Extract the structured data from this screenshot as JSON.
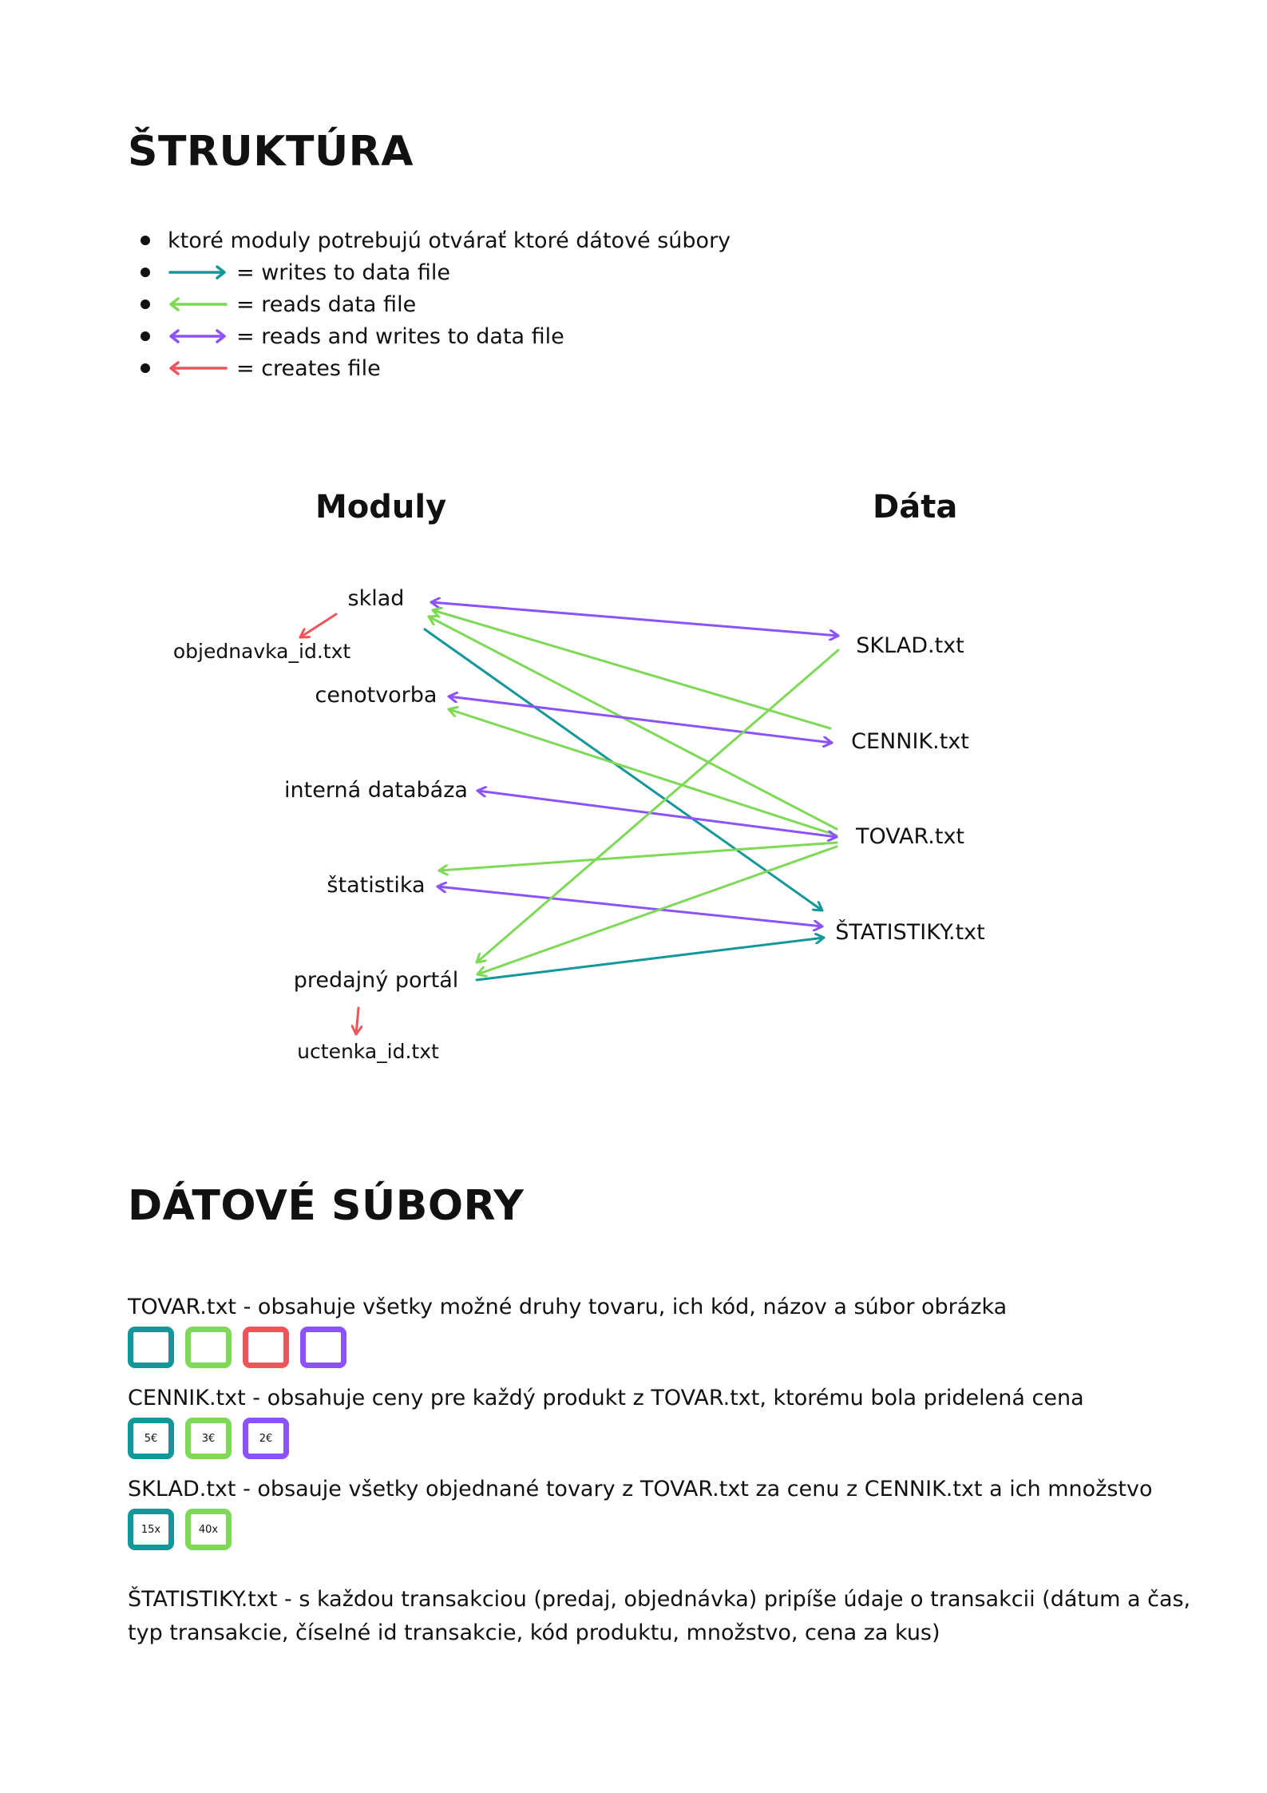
{
  "colors": {
    "teal": "#12979a",
    "green": "#7ed957",
    "red": "#f0545a",
    "purple": "#8c52ff"
  },
  "section1": {
    "title": "ŠTRUKTÚRA"
  },
  "legend": {
    "intro": "ktoré moduly potrebujú otvárať ktoré dátové súbory",
    "items": [
      {
        "color": "teal",
        "icon": "right-arrow-icon",
        "text": "= writes to data file"
      },
      {
        "color": "green",
        "icon": "left-arrow-icon",
        "text": "= reads data file"
      },
      {
        "color": "purple",
        "icon": "double-arrow-icon",
        "text": "= reads and writes to data file"
      },
      {
        "color": "red",
        "icon": "left-arrow-icon",
        "text": "= creates file"
      }
    ]
  },
  "diagram": {
    "modules_header": "Moduly",
    "data_header": "Dáta",
    "modules": [
      "sklad",
      "cenotvorba",
      "interná databáza",
      "štatistika",
      "predajný portál"
    ],
    "created_files": [
      "objednavka_id.txt",
      "uctenka_id.txt"
    ],
    "data_files": [
      "SKLAD.txt",
      "CENNIK.txt",
      "TOVAR.txt",
      "ŠTATISTIKY.txt"
    ],
    "relations": [
      {
        "module": "sklad",
        "file": "SKLAD.txt",
        "kind": "reads and writes"
      },
      {
        "module": "sklad",
        "file": "CENNIK.txt",
        "kind": "reads"
      },
      {
        "module": "sklad",
        "file": "TOVAR.txt",
        "kind": "reads"
      },
      {
        "module": "sklad",
        "file": "ŠTATISTIKY.txt",
        "kind": "writes"
      },
      {
        "module": "sklad",
        "file": "objednavka_id.txt",
        "kind": "creates"
      },
      {
        "module": "cenotvorba",
        "file": "CENNIK.txt",
        "kind": "reads and writes"
      },
      {
        "module": "cenotvorba",
        "file": "TOVAR.txt",
        "kind": "reads"
      },
      {
        "module": "interná databáza",
        "file": "TOVAR.txt",
        "kind": "reads and writes"
      },
      {
        "module": "štatistika",
        "file": "TOVAR.txt",
        "kind": "reads"
      },
      {
        "module": "štatistika",
        "file": "ŠTATISTIKY.txt",
        "kind": "reads and writes"
      },
      {
        "module": "predajný portál",
        "file": "SKLAD.txt",
        "kind": "reads"
      },
      {
        "module": "predajný portál",
        "file": "TOVAR.txt",
        "kind": "reads"
      },
      {
        "module": "predajný portál",
        "file": "ŠTATISTIKY.txt",
        "kind": "writes"
      },
      {
        "module": "predajný portál",
        "file": "uctenka_id.txt",
        "kind": "creates"
      }
    ]
  },
  "section2": {
    "title": "DÁTOVÉ SÚBORY"
  },
  "files": [
    {
      "description": "TOVAR.txt - obsahuje všetky možné druhy tovaru, ich kód, názov a súbor obrázka",
      "boxes": [
        {
          "color": "teal",
          "text": ""
        },
        {
          "color": "green",
          "text": ""
        },
        {
          "color": "red",
          "text": ""
        },
        {
          "color": "purple",
          "text": ""
        }
      ]
    },
    {
      "description": "CENNIK.txt - obsahuje ceny pre každý produkt z  TOVAR.txt, ktorému bola pridelená cena",
      "boxes": [
        {
          "color": "teal",
          "text": "5€"
        },
        {
          "color": "green",
          "text": "3€"
        },
        {
          "color": "purple",
          "text": "2€"
        }
      ]
    },
    {
      "description": "SKLAD.txt - obsauje všetky objednané tovary z TOVAR.txt za cenu z CENNIK.txt a ich množstvo",
      "boxes": [
        {
          "color": "teal",
          "text": "15x"
        },
        {
          "color": "green",
          "text": "40x"
        }
      ]
    },
    {
      "description": "ŠTATISTIKY.txt - s každou transakciou (predaj, objednávka) pripíše údaje o transakcii (dátum a čas, typ transakcie, číselné id transakcie, kód produktu, množstvo, cena za kus)",
      "boxes": []
    }
  ]
}
